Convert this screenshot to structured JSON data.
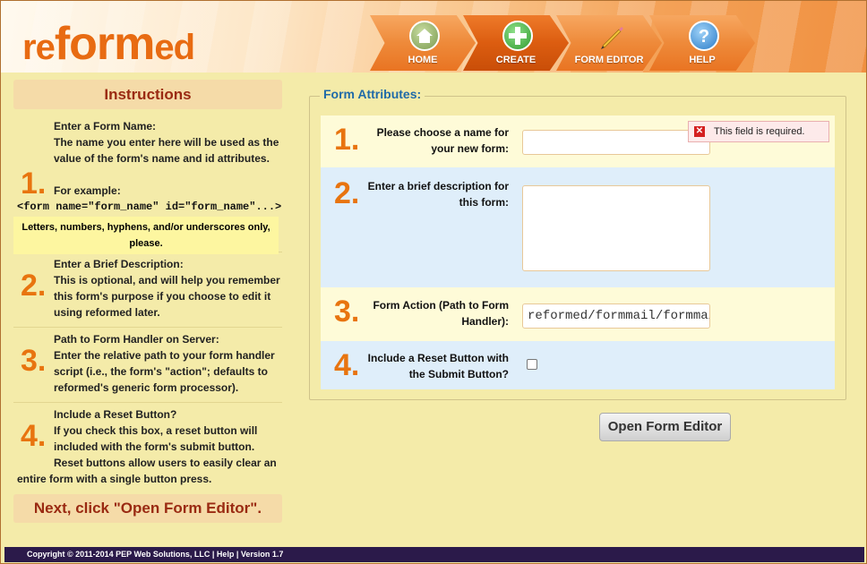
{
  "header": {
    "logo": {
      "re": "re",
      "form": "form",
      "ed": "ed"
    },
    "nav": [
      {
        "label": "HOME",
        "icon": "home-icon"
      },
      {
        "label": "CREATE",
        "icon": "plus-icon"
      },
      {
        "label": "FORM EDITOR",
        "icon": "pencil-icon"
      },
      {
        "label": "HELP",
        "icon": "help-icon"
      }
    ]
  },
  "instructions": {
    "title": "Instructions",
    "steps": [
      {
        "num": "1.",
        "title": "Enter a Form Name:",
        "body": "The name you enter here will be used as the value of the form's name and id attributes.",
        "example_label": "For example:",
        "code": "<form name=\"form_name\" id=\"form_name\"...>",
        "note": "Letters, numbers, hyphens, and/or underscores only, please."
      },
      {
        "num": "2.",
        "title": "Enter a Brief Description:",
        "body": "This is optional, and will help you remember this form's purpose if you choose to edit it using reformed later."
      },
      {
        "num": "3.",
        "title": "Path to Form Handler on Server:",
        "body": "Enter the relative path to your form handler script (i.e., the form's \"action\"; defaults to reformed's generic form processor)."
      },
      {
        "num": "4.",
        "title": "Include a Reset Button?",
        "body": "If you check this box, a reset button will included with the form's submit button.",
        "body2": "Reset buttons allow users to easily clear an entire form with a single button press."
      }
    ],
    "next": "Next, click \"Open Form Editor\"."
  },
  "form": {
    "legend": "Form Attributes:",
    "rows": [
      {
        "num": "1.",
        "label": "Please choose a name for your new form:",
        "value": ""
      },
      {
        "num": "2.",
        "label": "Enter a brief description for this form:",
        "value": ""
      },
      {
        "num": "3.",
        "label": "Form Action (Path to Form Handler):",
        "value": "reformed/formmail/formmail.php"
      },
      {
        "num": "4.",
        "label": "Include a Reset Button with the Submit Button?",
        "checked": false
      }
    ],
    "error": "This field is required.",
    "open_button": "Open Form Editor"
  },
  "footer": {
    "text": "Copyright © 2011-2014 PEP Web Solutions, LLC | Help | Version 1.7"
  },
  "colors": {
    "accent": "#e8740f",
    "header_orange": "#f09040",
    "title_red": "#9a2a12",
    "legend_blue": "#1f6aa8",
    "footer_bg": "#2b1a4a"
  }
}
